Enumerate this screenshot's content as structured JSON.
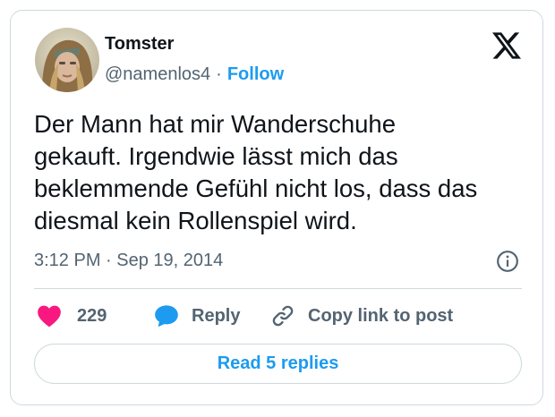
{
  "author": {
    "name": "Tomster",
    "handle": "@namenlos4",
    "separator": "·",
    "follow_label": "Follow"
  },
  "tweet": {
    "text": "Der Mann hat mir Wanderschuhe\ngekauft. Irgendwie lässt mich das\nbeklemmende Gefühl nicht los, dass das\ndiesmal kein Rollenspiel wird.",
    "timestamp": "3:12 PM · Sep 19, 2014"
  },
  "actions": {
    "like_count": "229",
    "reply_label": "Reply",
    "copy_link_label": "Copy link to post"
  },
  "read_replies_label": "Read 5 replies",
  "icons": {
    "brand": "x-logo-icon",
    "info": "info-icon",
    "like": "heart-icon",
    "reply": "speech-bubble-icon",
    "copy": "link-icon"
  },
  "colors": {
    "accent": "#1d9bf0",
    "heart": "#f91880",
    "text": "#0f1419",
    "muted": "#536471",
    "border": "#cfd9de"
  }
}
